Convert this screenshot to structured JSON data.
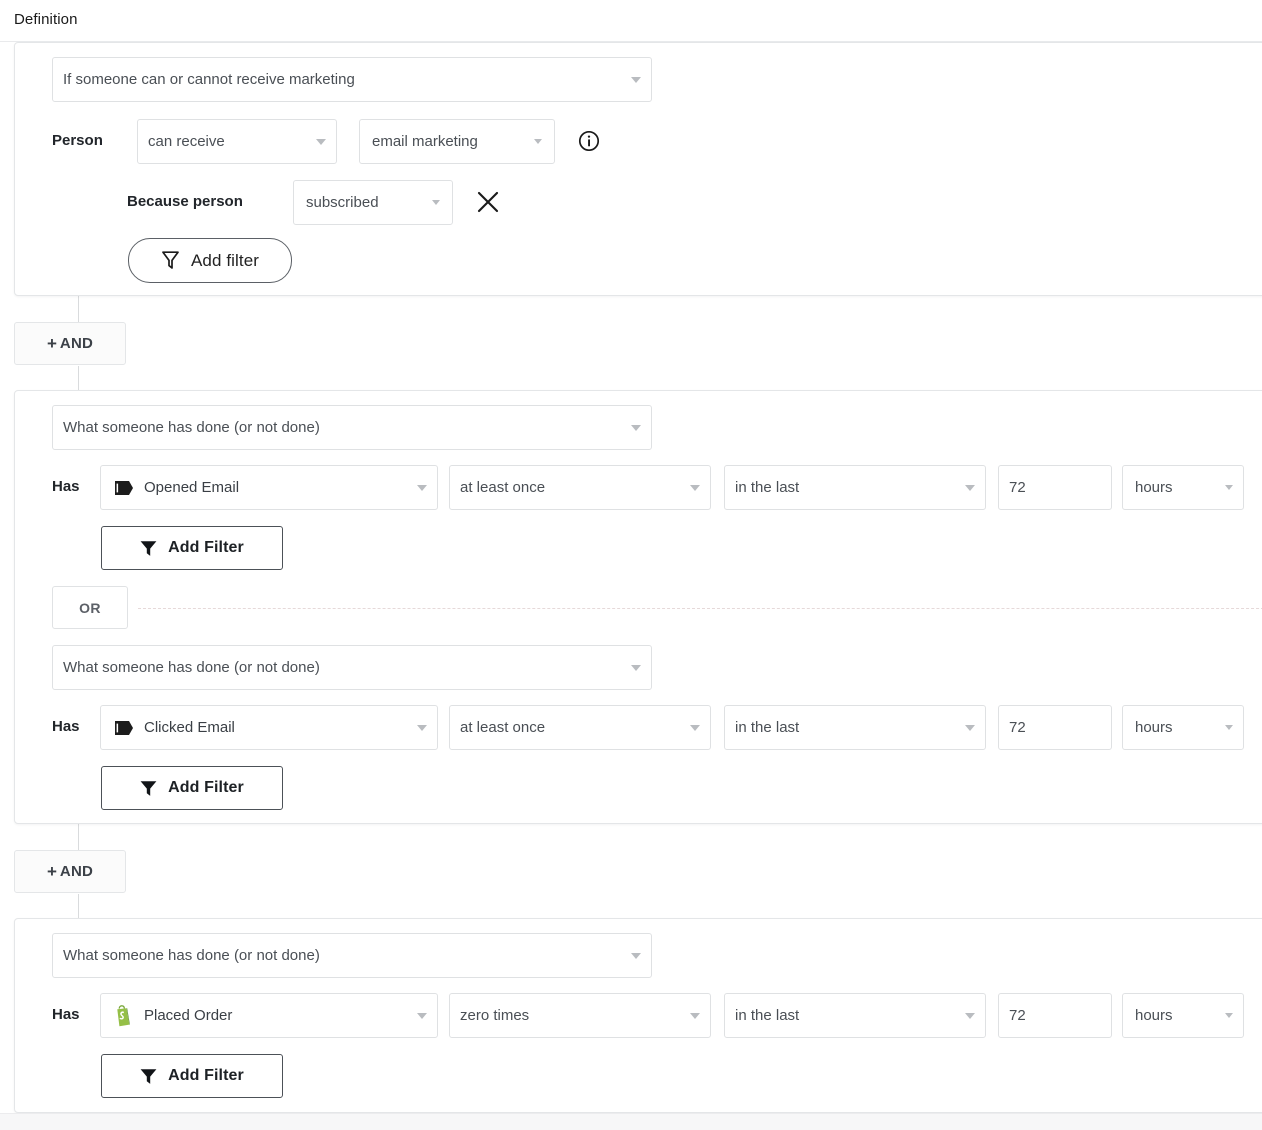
{
  "page": {
    "section_title": "Definition"
  },
  "blocks": [
    {
      "id": "block-marketing",
      "type_select": {
        "value": "If someone can or cannot receive marketing",
        "icon": "chevron-down-icon"
      },
      "person_label": "Person",
      "receive_select": {
        "value": "can receive"
      },
      "channel_select": {
        "value": "email marketing"
      },
      "info_icon": "info-circle-icon",
      "because_label": "Because person",
      "reason_select": {
        "value": "subscribed"
      },
      "remove_icon": "close-icon",
      "add_filter": {
        "label": "Add filter",
        "icon": "funnel-outline-icon"
      }
    },
    {
      "id": "block-behavior-1",
      "type_select": {
        "value": "What someone has done (or not done)"
      },
      "rows": [
        {
          "has_label": "Has",
          "metric": {
            "value": "Opened Email",
            "icon": "klaviyo-metric-icon"
          },
          "frequency": {
            "value": "at least once"
          },
          "timeframe": {
            "value": "in the last"
          },
          "amount": {
            "value": "72"
          },
          "unit": {
            "value": "hours"
          },
          "add_filter": {
            "label": "Add Filter",
            "icon": "funnel-solid-icon"
          }
        },
        {
          "has_label": "Has",
          "metric": {
            "value": "Clicked Email",
            "icon": "klaviyo-metric-icon"
          },
          "frequency": {
            "value": "at least once"
          },
          "timeframe": {
            "value": "in the last"
          },
          "amount": {
            "value": "72"
          },
          "unit": {
            "value": "hours"
          },
          "add_filter": {
            "label": "Add Filter",
            "icon": "funnel-solid-icon"
          }
        }
      ],
      "or_divider": {
        "label": "OR"
      },
      "inner_type_select": {
        "value": "What someone has done (or not done)"
      }
    },
    {
      "id": "block-behavior-2",
      "type_select": {
        "value": "What someone has done (or not done)"
      },
      "rows": [
        {
          "has_label": "Has",
          "metric": {
            "value": "Placed Order",
            "icon": "shopify-icon"
          },
          "frequency": {
            "value": "zero times"
          },
          "timeframe": {
            "value": "in the last"
          },
          "amount": {
            "value": "72"
          },
          "unit": {
            "value": "hours"
          },
          "add_filter": {
            "label": "Add Filter",
            "icon": "funnel-solid-icon"
          }
        }
      ]
    }
  ],
  "connectors": [
    {
      "label": "AND",
      "plus": "+"
    },
    {
      "label": "AND",
      "plus": "+"
    }
  ],
  "colors": {
    "card_border": "#e4e6e8",
    "select_border": "#dfe1e3",
    "text": "#4a4f55",
    "label_text": "#22262b",
    "shopify_green": "#95bf47",
    "metric_black": "#1c1c1c"
  }
}
